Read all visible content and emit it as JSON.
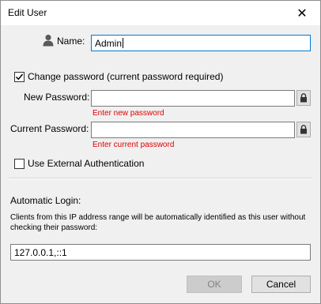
{
  "window": {
    "title": "Edit User",
    "close_glyph": "✕"
  },
  "name": {
    "label": "Name:",
    "value": "Admin",
    "icon": "user-icon"
  },
  "change_password": {
    "label": "Change password (current password required)",
    "checked": true
  },
  "new_password": {
    "label": "New Password:",
    "value": "",
    "error": "Enter new password",
    "lock_icon": "lock-icon"
  },
  "current_password": {
    "label": "Current Password:",
    "value": "",
    "error": "Enter current password",
    "lock_icon": "lock-icon"
  },
  "external_auth": {
    "label": "Use External Authentication",
    "checked": false
  },
  "auto_login": {
    "label": "Automatic Login:",
    "description": "Clients from this IP address range will be automatically identified as this user without checking their password:",
    "value": "127.0.0.1,::1"
  },
  "buttons": {
    "ok": "OK",
    "cancel": "Cancel"
  },
  "colors": {
    "error": "#e00000",
    "focus_border": "#0078d7",
    "dialog_bg": "#f0f0f0"
  }
}
